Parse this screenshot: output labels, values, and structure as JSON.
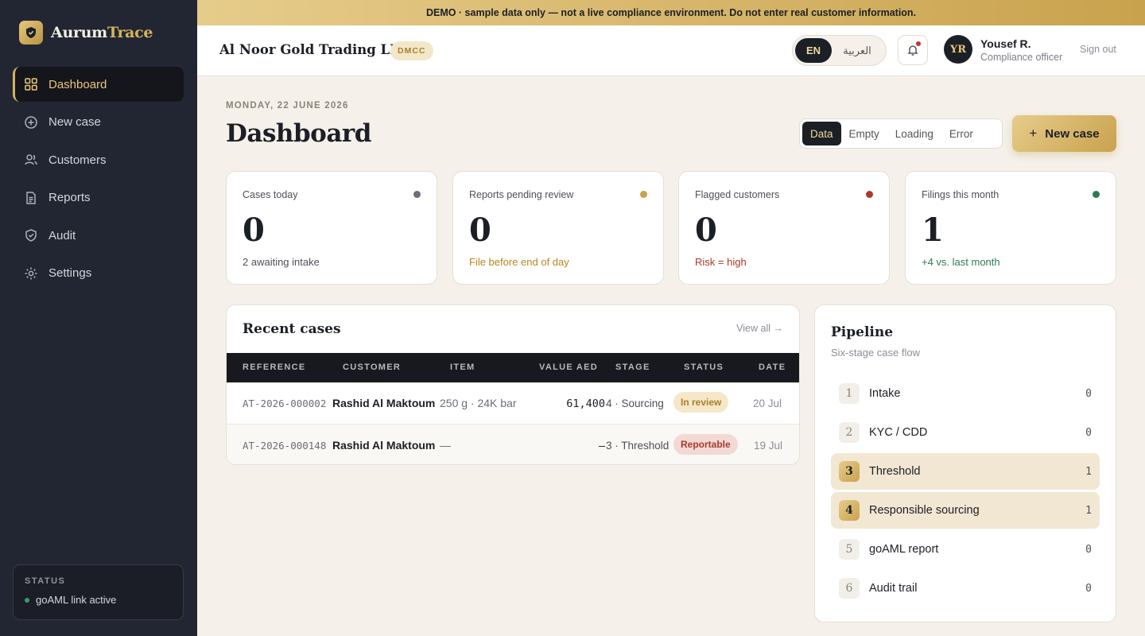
{
  "brand": {
    "name_part1": "Aurum",
    "name_part2": "Trace"
  },
  "nav": [
    {
      "label": "Dashboard",
      "icon": "grid-icon",
      "active": true
    },
    {
      "label": "New case",
      "icon": "plus-circle-icon"
    },
    {
      "label": "Customers",
      "icon": "users-icon"
    },
    {
      "label": "Reports",
      "icon": "document-icon"
    },
    {
      "label": "Audit",
      "icon": "shield-check-icon"
    },
    {
      "label": "Settings",
      "icon": "gear-icon"
    }
  ],
  "status": {
    "title": "STATUS",
    "text": "goAML link active"
  },
  "banner": "DEMO · sample data only — not a live compliance environment. Do not enter real customer information.",
  "header": {
    "org": "Al Noor Gold Trading LLC",
    "org_badge": "DMCC",
    "lang_en": "EN",
    "lang_ar": "العربية",
    "user_initials": "YR",
    "user_name": "Yousef R.",
    "user_role": "Compliance officer",
    "signout": "Sign out"
  },
  "page": {
    "date": "MONDAY, 22 JUNE 2026",
    "title": "Dashboard",
    "view_modes": [
      "Data",
      "Empty",
      "Loading",
      "Error"
    ],
    "new_case": "New case"
  },
  "cards": [
    {
      "label": "Cases today",
      "value": "0",
      "sub": "2 awaiting intake",
      "dot": "#6b6e76",
      "sub_color": "#4c5058"
    },
    {
      "label": "Reports pending review",
      "value": "0",
      "sub": "File before end of day",
      "dot": "#c9a24d",
      "sub_color": "#b8861f"
    },
    {
      "label": "Flagged customers",
      "value": "0",
      "sub": "Risk = high",
      "dot": "#a93a2c",
      "sub_color": "#a93a2c"
    },
    {
      "label": "Filings this month",
      "value": "1",
      "sub": "+4 vs. last month",
      "dot": "#2f7a55",
      "sub_color": "#2f7a55"
    }
  ],
  "recent": {
    "title": "Recent cases",
    "view_all": "View all →",
    "columns": [
      "REFERENCE",
      "CUSTOMER",
      "ITEM",
      "VALUE AED",
      "STAGE",
      "STATUS",
      "DATE"
    ],
    "rows": [
      {
        "ref": "AT-2026-000002",
        "customer": "Rashid Al Maktoum",
        "item": "250 g · 24K bar",
        "value": "61,400",
        "stage": "4 · Sourcing",
        "status": "In review",
        "date": "20 Jul"
      },
      {
        "ref": "AT-2026-000148",
        "customer": "Rashid Al Maktoum",
        "item": "—",
        "value": "—",
        "stage": "3 · Threshold",
        "status": "Reportable",
        "date": "19 Jul"
      }
    ]
  },
  "pipeline": {
    "title": "Pipeline",
    "subtitle": "Six-stage case flow",
    "stages": [
      {
        "num": "1",
        "name": "Intake",
        "count": "0"
      },
      {
        "num": "2",
        "name": "KYC / CDD",
        "count": "0"
      },
      {
        "num": "3",
        "name": "Threshold",
        "count": "1",
        "highlight": true
      },
      {
        "num": "4",
        "name": "Responsible sourcing",
        "count": "1",
        "highlight": true
      },
      {
        "num": "5",
        "name": "goAML report",
        "count": "0"
      },
      {
        "num": "6",
        "name": "Audit trail",
        "count": "0"
      }
    ]
  }
}
